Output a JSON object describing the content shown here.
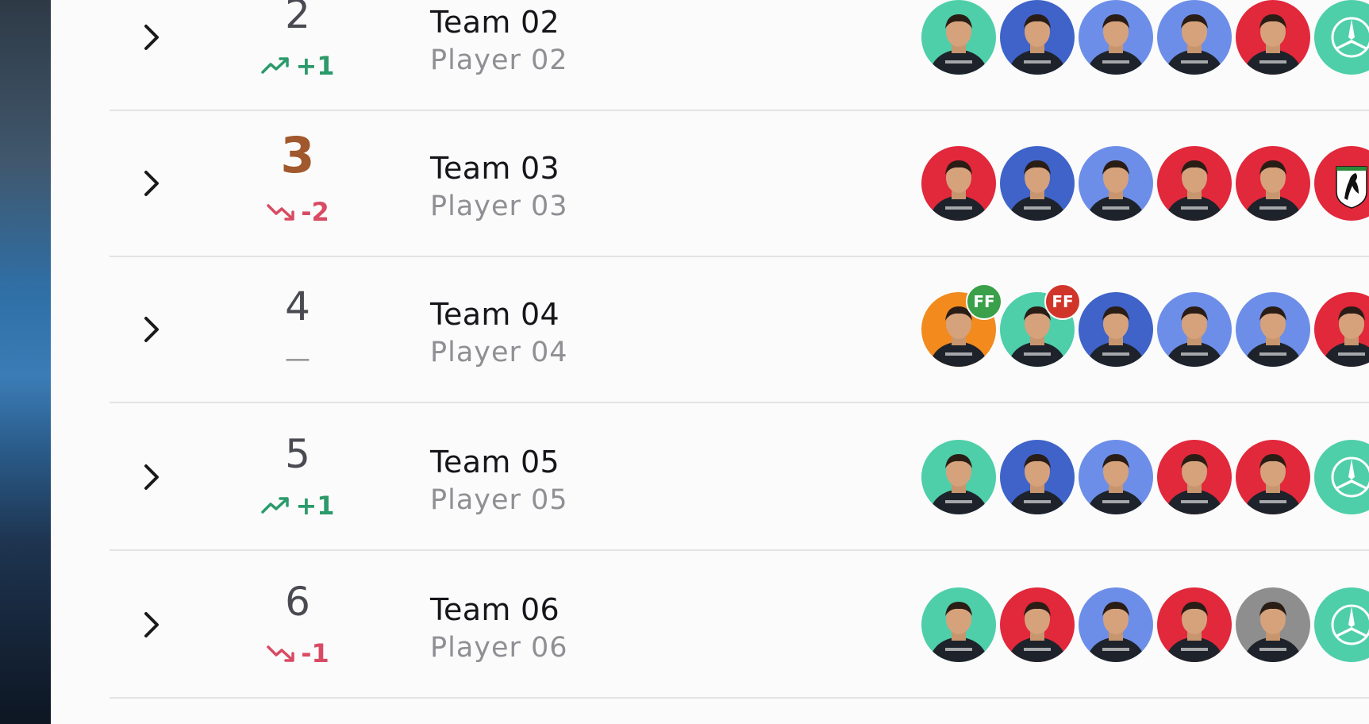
{
  "rows": [
    {
      "rank": "2",
      "change": "+1",
      "trend": "up",
      "team": "Team 02",
      "player": "Player 02",
      "avatars": [
        "teal",
        "blue",
        "lightblue",
        "lightblue",
        "red",
        "teal-logo"
      ]
    },
    {
      "rank": "3",
      "change": "-2",
      "trend": "down",
      "team": "Team 03",
      "player": "Player 03",
      "avatars": [
        "red",
        "blue",
        "lightblue",
        "red",
        "red",
        "ferrari-logo"
      ]
    },
    {
      "rank": "4",
      "change": "—",
      "trend": "same",
      "team": "Team 04",
      "player": "Player 04",
      "avatars": [
        "orange",
        "teal",
        "blue",
        "lightblue",
        "lightblue",
        "red"
      ],
      "badges": [
        "FF",
        "FF"
      ]
    },
    {
      "rank": "5",
      "change": "+1",
      "trend": "up",
      "team": "Team 05",
      "player": "Player 05",
      "avatars": [
        "teal",
        "blue",
        "lightblue",
        "red",
        "red",
        "teal-logo"
      ]
    },
    {
      "rank": "6",
      "change": "-1",
      "trend": "down",
      "team": "Team 06",
      "player": "Player 06",
      "avatars": [
        "teal",
        "red",
        "lightblue",
        "red",
        "gray",
        "teal-logo"
      ]
    }
  ],
  "colors": {
    "teal": "#4ecfa9",
    "blue": "#3f63c9",
    "lightblue": "#6d8ee8",
    "red": "#e2283b",
    "orange": "#f28a1e",
    "gray": "#8e8e8e",
    "badge_green": "#3aa04a",
    "badge_red": "#d1352a",
    "up": "#2c9a6a",
    "down": "#d94a63",
    "bronze": "#a0582c"
  },
  "icons": {
    "chevron": "chevron-right-icon",
    "up": "trend-up-icon",
    "down": "trend-down-icon",
    "teal-logo": "mercedes-star-icon",
    "ferrari-logo": "prancing-horse-icon"
  }
}
